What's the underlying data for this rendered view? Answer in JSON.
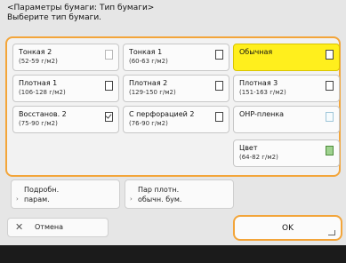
{
  "header": {
    "line1": "<Параметры бумаги: Тип бумаги>",
    "line2": "Выберите тип бумаги."
  },
  "paper_types": [
    {
      "name": "Тонкая 2",
      "range": "(52-59 г/м2)",
      "icon": "paper-icon",
      "selected": false
    },
    {
      "name": "Тонкая 1",
      "range": "(60-63 г/м2)",
      "icon": "paper-icon",
      "selected": false
    },
    {
      "name": "Обычная",
      "range": "",
      "icon": "paper-icon",
      "selected": true
    },
    {
      "name": "Плотная 1",
      "range": "(106-128 г/м2)",
      "icon": "paper-icon",
      "selected": false
    },
    {
      "name": "Плотная 2",
      "range": "(129-150 г/м2)",
      "icon": "paper-icon",
      "selected": false
    },
    {
      "name": "Плотная 3",
      "range": "(151-163 г/м2)",
      "icon": "paper-icon",
      "selected": false
    },
    {
      "name": "Восстанов. 2",
      "range": "(75-90 г/м2)",
      "icon": "recycled-paper-icon",
      "selected": false
    },
    {
      "name": "С перфорацией 2",
      "range": "(76-90 г/м2)",
      "icon": "paper-icon",
      "selected": false
    },
    {
      "name": "OHP-пленка",
      "range": "",
      "icon": "transparency-icon",
      "selected": false
    },
    {
      "name": "Цвет",
      "range": "(64-82 г/м2)",
      "icon": "color-paper-icon",
      "selected": false
    }
  ],
  "buttons": {
    "details_line1": "Подробн.",
    "details_line2": "парам.",
    "frequent_line1": "Пар плотн.",
    "frequent_line2": "обычн. бум.",
    "cancel": "Отмена",
    "cancel_icon": "close-icon",
    "ok": "OK"
  },
  "colors": {
    "accent": "#f3a53a",
    "selected": "#ffef1d"
  }
}
